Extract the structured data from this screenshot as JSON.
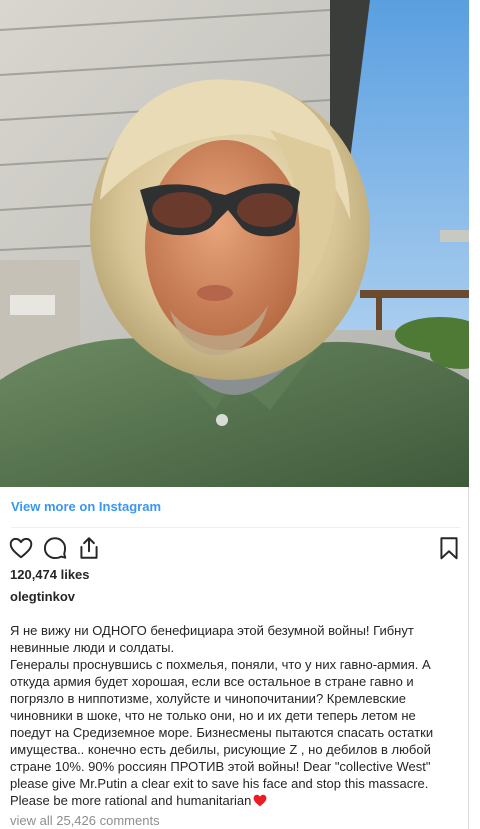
{
  "post": {
    "view_more_label": "View more on Instagram",
    "likes": "120,474 likes",
    "username": "olegtinkov",
    "caption": "Я не вижу ни ОДНОГО бенефициара этой безумной войны! Гибнут\nневинные люди и солдаты󠁧.\nГенералы проснувшись с похмелья, поняли, что у них гавно-армия. А\nоткуда армия будет хорошая, если все остальное в стране гавно и\nпогрязло в ниппотизме, холуйсте и чинопочитании? Кремлевские\nчиновники в шоке, что не только они, но и их дети теперь летом не\nпоедут на Средиземное море. Бизнесмены пытаются спасать остатки\nимущества.. конечно есть дебилы, рисующие Z , но дебилов в любой\nстране 10%. 90% россиян ПРОТИВ этой войны! Dear \"collective West\"\nplease give Mr.Putin a clear exit to save his face and stop this massacre.\nPlease be more rational and humanitarian",
    "comments_link": "view all 25,426 comments"
  },
  "icons": {
    "like": "heart-outline-icon",
    "comment": "comment-bubble-icon",
    "share": "share-icon",
    "save": "bookmark-icon",
    "caption_emoji": "red-heart-icon"
  },
  "colors": {
    "link": "#3897f0",
    "text": "#262626",
    "muted": "#8e8e8e",
    "heart": "#ed1c24"
  }
}
